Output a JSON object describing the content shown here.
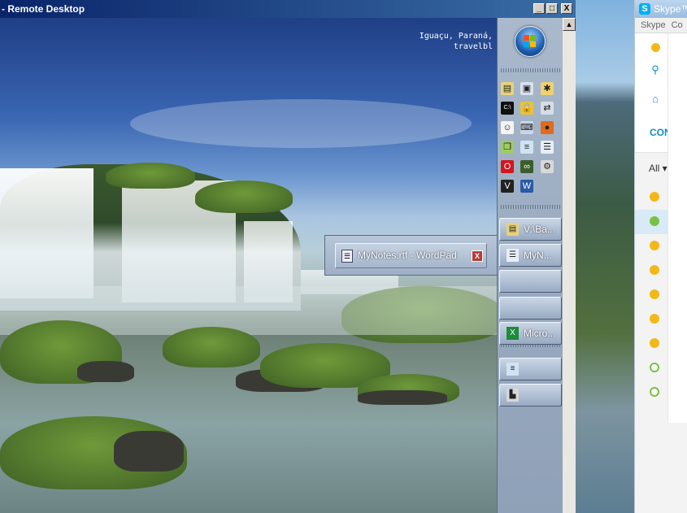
{
  "remote_desktop": {
    "title": "- Remote Desktop",
    "controls": {
      "minimize": "_",
      "maximize": "□",
      "close": "X"
    },
    "scroll_up": "▲",
    "wallpaper_caption": {
      "line1": "Iguaçu, Paraná, ",
      "line2": "travelbl"
    }
  },
  "launcher": {
    "quick_launch": [
      {
        "name": "folder-icon",
        "glyph": "▤",
        "bg": "#e7d27a"
      },
      {
        "name": "computer-icon",
        "glyph": "▣",
        "bg": "#d9e1ee"
      },
      {
        "name": "paint-icon",
        "glyph": "✱",
        "bg": "#f0d070"
      },
      {
        "name": "command-prompt-icon",
        "glyph": "C:\\",
        "bg": "#101010"
      },
      {
        "name": "lock-icon",
        "glyph": "🔒",
        "bg": "#e7c23a"
      },
      {
        "name": "network-icon",
        "glyph": "⇄",
        "bg": "#d7dde8"
      },
      {
        "name": "person-icon",
        "glyph": "☺",
        "bg": "#f4f4f4"
      },
      {
        "name": "keyboard-icon",
        "glyph": "⌨",
        "bg": "#c9d6e8"
      },
      {
        "name": "firefox-icon",
        "glyph": "●",
        "bg": "#e06b1c"
      },
      {
        "name": "files-icon",
        "glyph": "❐",
        "bg": "#9fcc5e"
      },
      {
        "name": "notepad-icon",
        "glyph": "≡",
        "bg": "#cfe3f2"
      },
      {
        "name": "document-icon",
        "glyph": "☰",
        "bg": "#e8eef6"
      },
      {
        "name": "opera-icon",
        "glyph": "O",
        "bg": "#d3161c"
      },
      {
        "name": "binoculars-icon",
        "glyph": "∞",
        "bg": "#3b5d2c"
      },
      {
        "name": "tools-icon",
        "glyph": "⚙",
        "bg": "#d8d8d8"
      },
      {
        "name": "vnc-icon",
        "glyph": "V",
        "bg": "#222222"
      },
      {
        "name": "word-icon",
        "glyph": "W",
        "bg": "#2b5aa8"
      }
    ],
    "tasks": [
      {
        "name": "task-folder",
        "label": "V:\\Ba...",
        "icon": "folder-icon",
        "glyph": "▤",
        "icon_bg": "#e7d27a"
      },
      {
        "name": "task-wordpad",
        "label": "MyN...",
        "icon": "wordpad-icon",
        "glyph": "☰",
        "icon_bg": "#e8eef6"
      },
      {
        "name": "task-empty",
        "label": "",
        "icon": "",
        "glyph": "",
        "icon_bg": ""
      },
      {
        "name": "task-excel",
        "label": "Micro...",
        "icon": "excel-icon",
        "glyph": "X",
        "icon_bg": "#1f8a3b"
      },
      {
        "name": "task-notepad",
        "label": "",
        "icon": "notepad-icon",
        "glyph": "≡",
        "icon_bg": "#cfe3f2"
      },
      {
        "name": "task-installer",
        "label": "",
        "icon": "installer-icon",
        "glyph": "▙",
        "icon_bg": "#d8d8d8"
      }
    ]
  },
  "popup": {
    "label": "MyNotes.rtf - WordPad",
    "close": "X"
  },
  "skype": {
    "title": "Skype™",
    "menu": [
      "Skype",
      "Co"
    ],
    "contacts_label": "CON",
    "filter_label": "All ▾",
    "statuses": [
      "away",
      "online",
      "away",
      "away",
      "away",
      "away",
      "away",
      "offline",
      "offline"
    ],
    "status_colors": {
      "away": "#f2b817",
      "online": "#7ac142",
      "offline": "#7ac142"
    }
  }
}
